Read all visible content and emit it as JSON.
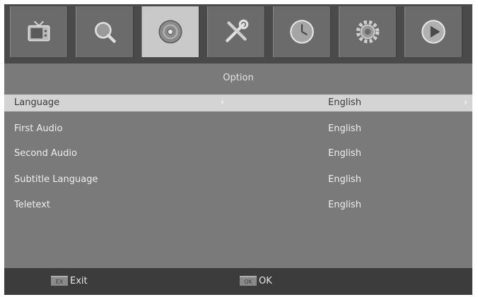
{
  "menu": {
    "tabs": [
      {
        "icon": "tv-icon"
      },
      {
        "icon": "search-icon"
      },
      {
        "icon": "disc-icon"
      },
      {
        "icon": "tools-icon"
      },
      {
        "icon": "clock-icon"
      },
      {
        "icon": "gear-icon"
      },
      {
        "icon": "play-icon"
      }
    ],
    "active_tab_index": 2
  },
  "panel": {
    "title": "Option",
    "rows": [
      {
        "label": "Language",
        "value": "English",
        "selected": true
      },
      {
        "label": "First Audio",
        "value": "English"
      },
      {
        "label": "Second Audio",
        "value": "English"
      },
      {
        "label": "Subtitle Language",
        "value": "English"
      },
      {
        "label": "Teletext",
        "value": "English"
      }
    ]
  },
  "footer": {
    "exit_key": "EX",
    "exit_label": "Exit",
    "ok_key": "OK",
    "ok_label": "OK"
  },
  "colors": {
    "background": "#7a7a7a",
    "topbar": "#4a4a4a",
    "selected_row": "#d4d4d4",
    "footer": "#3c3c3c"
  }
}
